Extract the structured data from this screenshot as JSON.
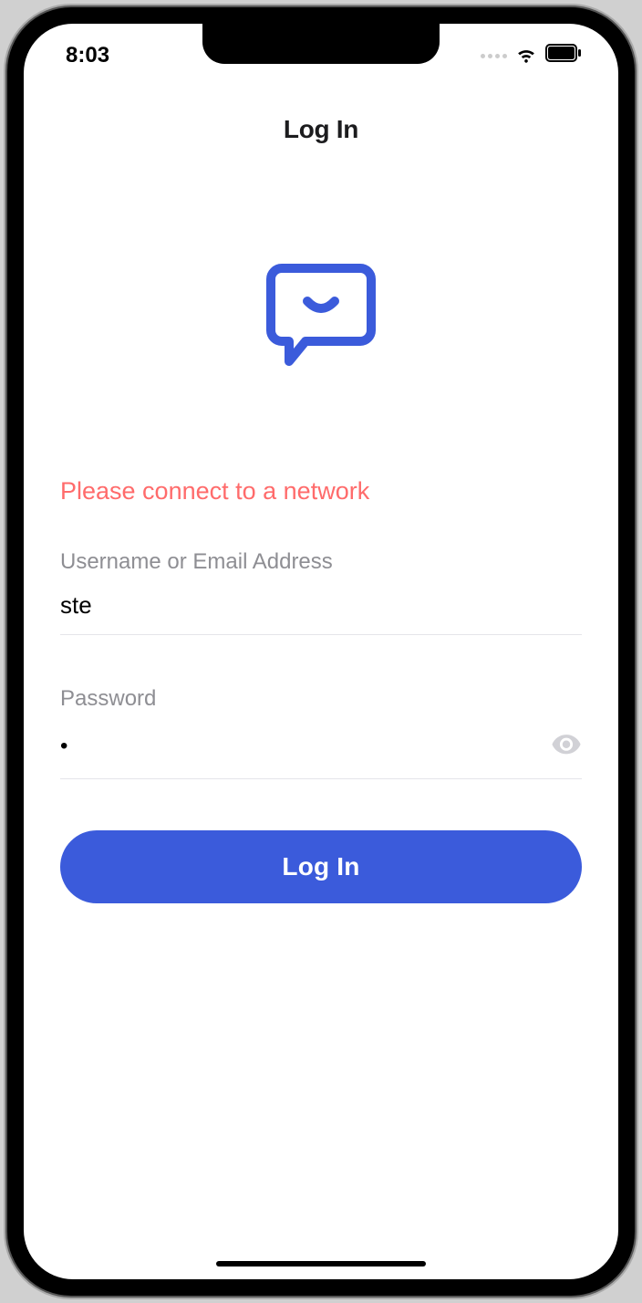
{
  "status_bar": {
    "time": "8:03"
  },
  "page_title": "Log In",
  "error_message": "Please connect to a network",
  "form": {
    "username": {
      "label": "Username or Email Address",
      "value": "ste"
    },
    "password": {
      "label": "Password",
      "value": "•"
    },
    "submit_label": "Log In"
  },
  "colors": {
    "primary": "#3b5bdb",
    "error": "#ff6b6b",
    "muted": "#8e8e93"
  }
}
